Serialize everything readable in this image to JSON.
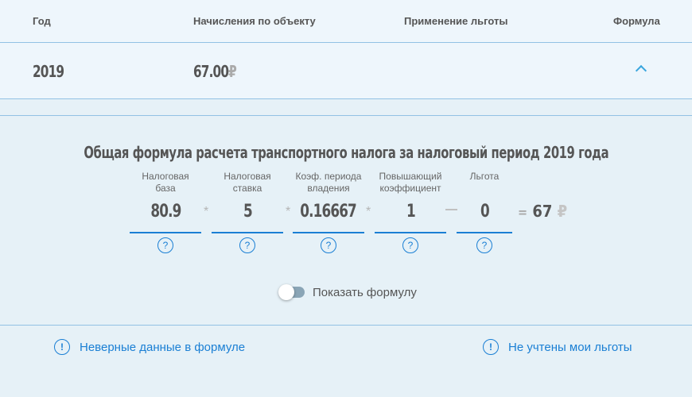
{
  "table": {
    "headers": {
      "year": "Год",
      "accruals": "Начисления по объекту",
      "benefit": "Применение льготы",
      "formula": "Формула"
    },
    "row": {
      "year": "2019",
      "amount": "67.00",
      "currency": "₽",
      "benefit": "",
      "toggle_icon": "chevron-up-icon"
    }
  },
  "formula": {
    "title": "Общая формула расчета транспортного налога за налоговый период 2019 года",
    "fields": [
      {
        "label_line1": "Налоговая",
        "label_line2": "база",
        "value": "80.9",
        "help_icon": "?"
      },
      {
        "label_line1": "Налоговая",
        "label_line2": "ставка",
        "value": "5",
        "help_icon": "?"
      },
      {
        "label_line1": "Коэф. периода",
        "label_line2": "владения",
        "value": "0.16667",
        "help_icon": "?"
      },
      {
        "label_line1": "Повышающий",
        "label_line2": "коэффициент",
        "value": "1",
        "help_icon": "?"
      },
      {
        "label_line1": "Льгота",
        "label_line2": "",
        "value": "0",
        "help_icon": "?"
      }
    ],
    "operators": [
      "*",
      "*",
      "*",
      "−"
    ],
    "result": {
      "equals": "=",
      "value": "67",
      "currency": "₽"
    },
    "show_formula": {
      "label": "Показать формулу",
      "enabled": false
    }
  },
  "links": {
    "wrong_data": {
      "label": "Неверные данные в формуле",
      "icon": "!"
    },
    "benefits_missing": {
      "label": "Не учтены мои льготы",
      "icon": "!"
    }
  }
}
